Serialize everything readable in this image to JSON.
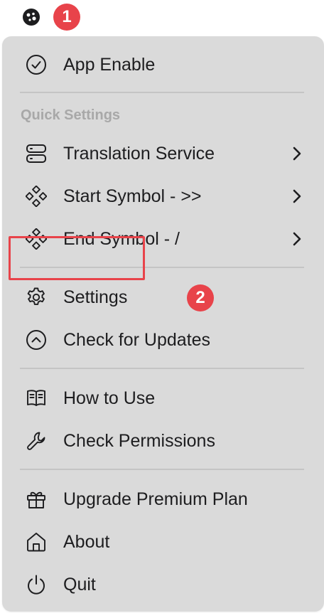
{
  "menubar": {
    "app_icon": "app-tray-icon"
  },
  "annotations": {
    "step1": "1",
    "step2": "2",
    "accent_color": "#e8434a"
  },
  "menu": {
    "background": "#dadada",
    "app_enable": {
      "label": "App Enable",
      "icon": "check-circle-icon"
    },
    "quick_settings_header": "Quick Settings",
    "translation_service": {
      "label": "Translation Service",
      "icon": "server-icon"
    },
    "start_symbol": {
      "label": "Start Symbol - >>",
      "icon": "diamond-dots-icon"
    },
    "end_symbol": {
      "label": "End Symbol - /",
      "icon": "diamond-dots-icon"
    },
    "settings": {
      "label": "Settings",
      "icon": "gear-icon"
    },
    "check_updates": {
      "label": "Check for Updates",
      "icon": "chevron-up-circle-icon"
    },
    "how_to_use": {
      "label": "How to Use",
      "icon": "book-icon"
    },
    "check_permissions": {
      "label": "Check Permissions",
      "icon": "wrench-icon"
    },
    "upgrade": {
      "label": "Upgrade Premium Plan",
      "icon": "gift-icon"
    },
    "about": {
      "label": "About",
      "icon": "home-icon"
    },
    "quit": {
      "label": "Quit",
      "icon": "power-icon"
    }
  }
}
